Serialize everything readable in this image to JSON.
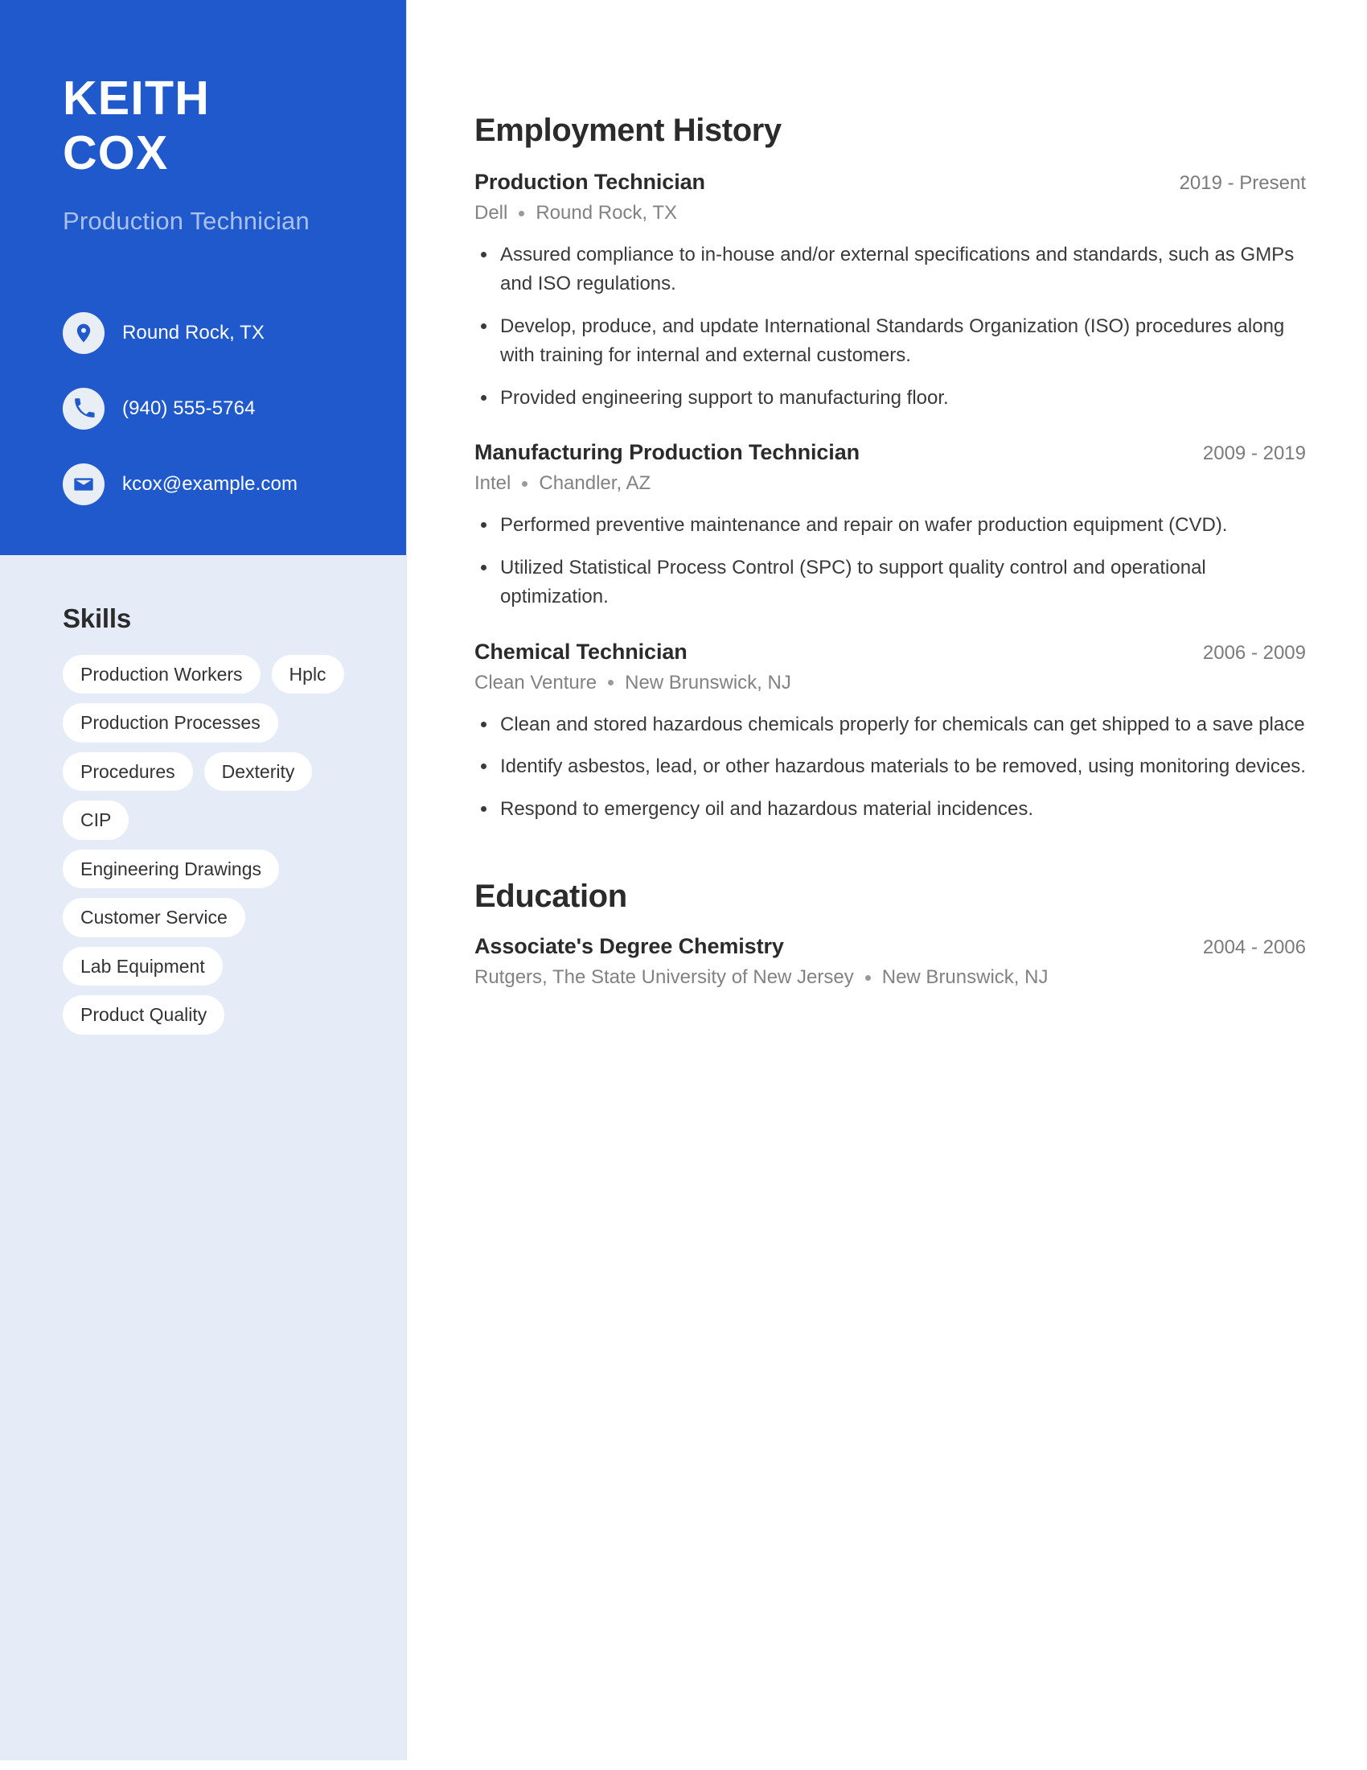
{
  "theme": {
    "accent_blue": "#2059cb",
    "sidebar_bg": "#e6ecf7",
    "chip_bg": "#ffffff",
    "subtitle_color": "#a9c0ea",
    "text_dark": "#2b2b2b",
    "text_muted": "#828282"
  },
  "header": {
    "first_name": "KEITH",
    "last_name": "COX",
    "job_title": "Production Technician"
  },
  "contacts": [
    {
      "icon": "location-pin-icon",
      "value": "Round Rock, TX"
    },
    {
      "icon": "phone-icon",
      "value": "(940) 555-5764"
    },
    {
      "icon": "envelope-icon",
      "value": "kcox@example.com"
    }
  ],
  "skills": {
    "title": "Skills",
    "items": [
      "Production Workers",
      "Hplc",
      "Production Processes",
      "Procedures",
      "Dexterity",
      "CIP",
      "Engineering Drawings",
      "Customer Service",
      "Lab Equipment",
      "Product Quality"
    ]
  },
  "employment": {
    "title": "Employment History",
    "entries": [
      {
        "role": "Production Technician",
        "dates": "2019 - Present",
        "company": "Dell",
        "location": "Round Rock, TX",
        "bullets": [
          "Assured compliance to in-house and/or external specifications and standards, such as GMPs and ISO regulations.",
          "Develop, produce, and update International Standards Organization (ISO) procedures along with training for internal and external customers.",
          "Provided engineering support to manufacturing floor."
        ]
      },
      {
        "role": "Manufacturing Production Technician",
        "dates": "2009 - 2019",
        "company": "Intel",
        "location": "Chandler, AZ",
        "bullets": [
          "Performed preventive maintenance and repair on wafer production equipment (CVD).",
          "Utilized Statistical Process Control (SPC) to support quality control and operational optimization."
        ]
      },
      {
        "role": "Chemical Technician",
        "dates": "2006 - 2009",
        "company": "Clean Venture",
        "location": "New Brunswick, NJ",
        "bullets": [
          "Clean and stored hazardous chemicals properly for chemicals can get shipped to a save place",
          "Identify asbestos, lead, or other hazardous materials to be removed, using monitoring devices.",
          "Respond to emergency oil and hazardous material incidences."
        ]
      }
    ]
  },
  "education": {
    "title": "Education",
    "entries": [
      {
        "degree": "Associate's Degree Chemistry",
        "dates": "2004 - 2006",
        "school": "Rutgers, The State University of New Jersey",
        "location": "New Brunswick, NJ"
      }
    ]
  }
}
